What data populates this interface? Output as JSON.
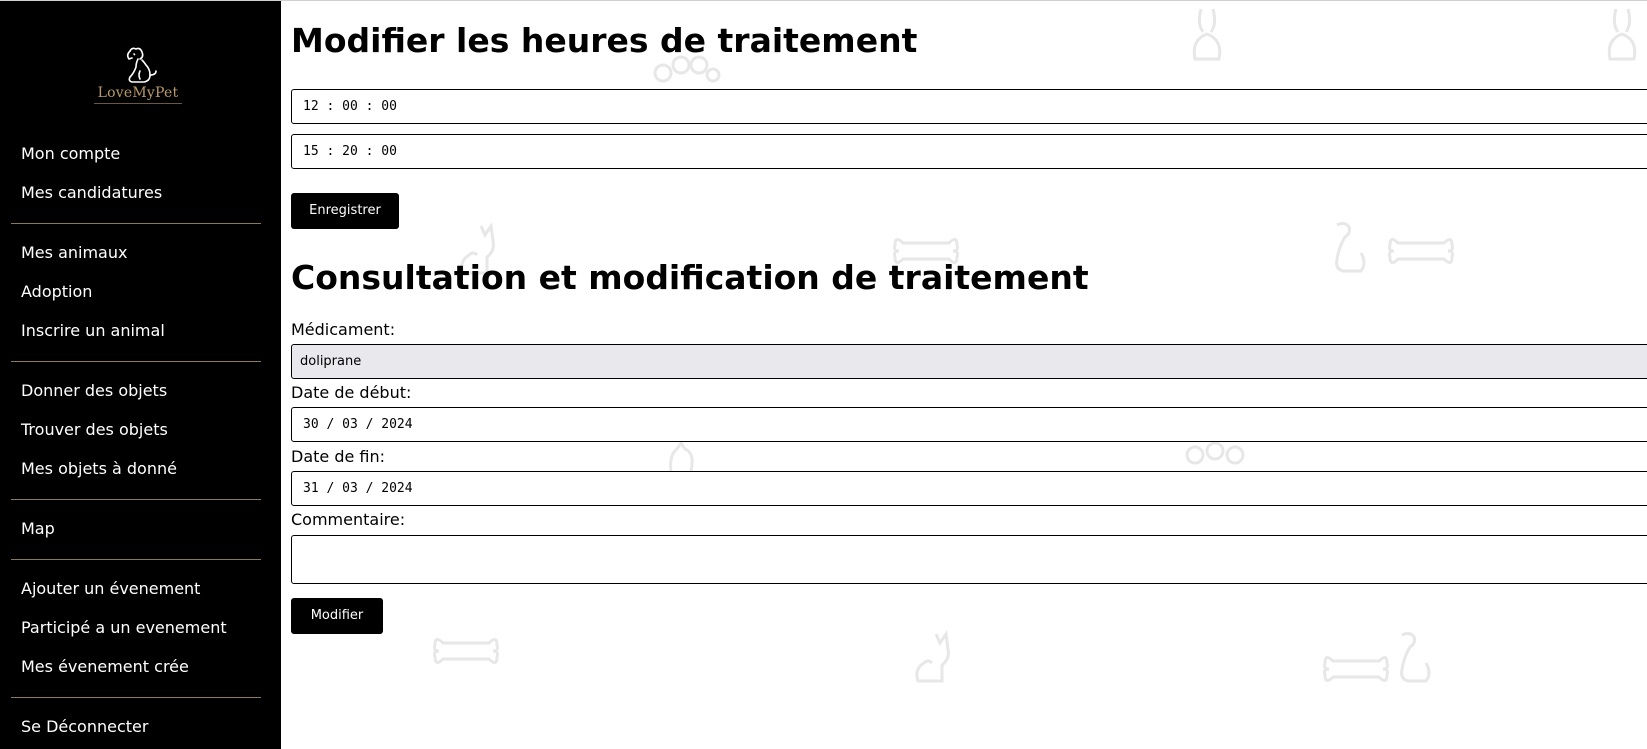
{
  "sidebar": {
    "logo_text": "LoveMyPet",
    "items": [
      {
        "label": "Mon compte"
      },
      {
        "label": "Mes candidatures"
      },
      {
        "label": "Mes animaux"
      },
      {
        "label": "Adoption"
      },
      {
        "label": "Inscrire un animal"
      },
      {
        "label": "Donner des objets"
      },
      {
        "label": "Trouver des objets"
      },
      {
        "label": "Mes objets à donné"
      },
      {
        "label": "Map"
      },
      {
        "label": "Ajouter un évenement"
      },
      {
        "label": "Participé a un evenement"
      },
      {
        "label": "Mes évenement crée"
      },
      {
        "label": "Se Déconnecter"
      }
    ]
  },
  "hours_section": {
    "title": "Modifier les heures de traitement",
    "time_1": "12 : 00 : 00",
    "time_2": "15 : 20 : 00",
    "save_label": "Enregistrer"
  },
  "treatment_section": {
    "title": "Consultation et modification de traitement",
    "medicament_label": "Médicament:",
    "medicament_value": "doliprane",
    "start_label": "Date de début:",
    "start_value": "30 / 03 / 2024",
    "end_label": "Date de fin:",
    "end_value": "31 / 03 / 2024",
    "comment_label": "Commentaire:",
    "comment_value": "",
    "modify_label": "Modifier"
  },
  "colors": {
    "sidebar_bg": "#000000",
    "accent_gold": "#b89a6a",
    "button_bg": "#000000"
  }
}
